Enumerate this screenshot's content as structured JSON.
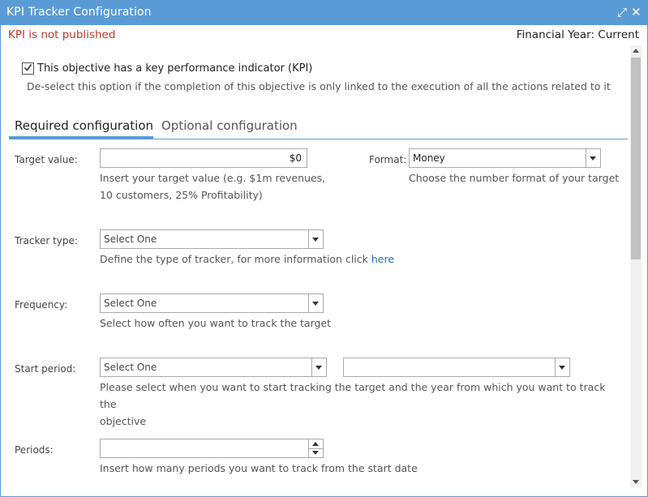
{
  "window": {
    "title": "KPI Tracker Configuration",
    "icons": [
      "expand-icon",
      "close-icon"
    ],
    "expand_glyph": "⤢",
    "close_glyph": "✕"
  },
  "status": {
    "publish_status": "KPI is not published",
    "financial_year": "Financial Year: Current"
  },
  "kpi_option": {
    "checked": true,
    "label": "This objective has a key performance indicator (KPI)",
    "help": "De-select this option if the completion of this objective is only linked to the execution of all the actions related to it"
  },
  "tabs": [
    {
      "label": "Required configuration",
      "active": true
    },
    {
      "label": "Optional configuration",
      "active": false
    }
  ],
  "form": {
    "target_value": {
      "label": "Target value:",
      "value": "$0",
      "help_line1": "Insert your target value (e.g. $1m revenues,",
      "help_line2": "10 customers, 25% Profitability)"
    },
    "format": {
      "label": "Format:",
      "value": "Money",
      "help": "Choose the number format of your target"
    },
    "tracker_type": {
      "label": "Tracker type:",
      "value": "Select One",
      "help": "Define the type of tracker, for more information click ",
      "link": "here"
    },
    "frequency": {
      "label": "Frequency:",
      "value": "Select One",
      "help": "Select how often you want to track the target"
    },
    "start_period": {
      "label": "Start period:",
      "value": "Select One",
      "year_value": "",
      "help_line1": "Please select when you want to start tracking the target and the year from which you want to track the",
      "help_line2": "objective"
    },
    "periods": {
      "label": "Periods:",
      "value": "",
      "help": "Insert how many periods you want to track from the start date"
    }
  },
  "colors": {
    "accent": "#5b9bd5",
    "status_red": "#c0392b",
    "link": "#2a6ebb"
  }
}
